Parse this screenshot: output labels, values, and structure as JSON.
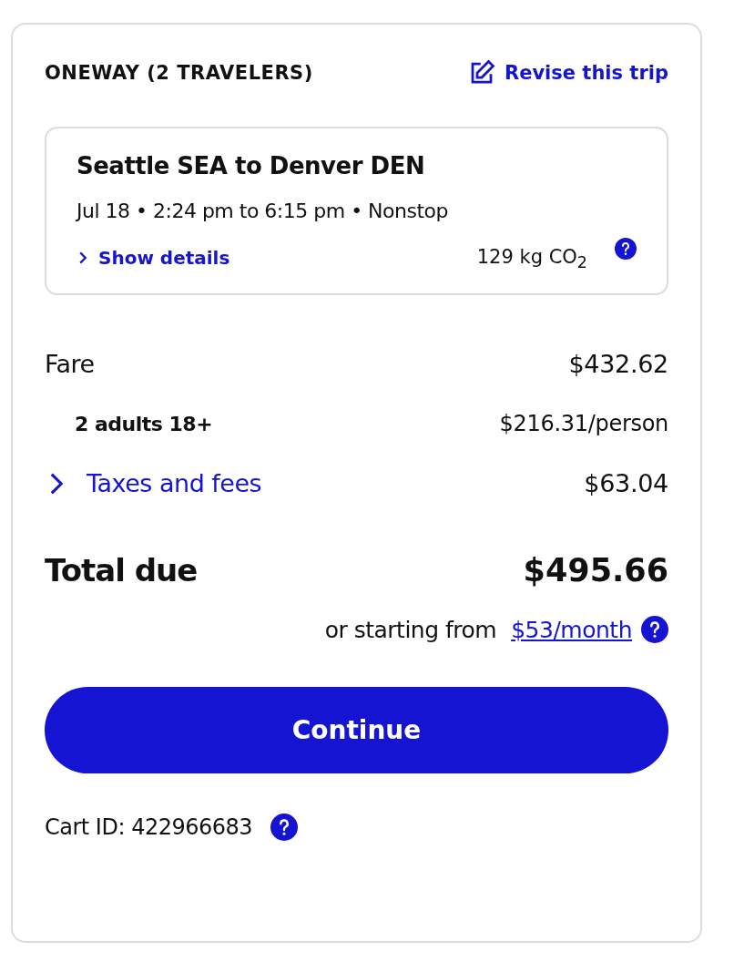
{
  "header": {
    "title": "ONEWAY (2 TRAVELERS)",
    "revise_link": "Revise this trip"
  },
  "flight": {
    "route": "Seattle SEA to Denver DEN",
    "schedule": "Jul 18 • 2:24 pm to 6:15 pm • Nonstop",
    "details_link": "Show details",
    "emissions": "129 kg CO$_{2}$"
  },
  "price_lines": [
    {
      "kind": "main",
      "label": "Fare",
      "amount": "$432.62"
    },
    {
      "kind": "sub",
      "label": "2 adults 18+",
      "amount": "$216.31/person"
    },
    {
      "kind": "expandable",
      "label": "Taxes and fees",
      "amount": "$63.04",
      "expanded": false
    }
  ],
  "total": {
    "label": "Total due",
    "amount": "$495.66"
  },
  "financing": {
    "text": "or starting from",
    "link": "$53/month"
  },
  "continue_button": "Continue",
  "cart_id": "Cart ID: 422966683"
}
